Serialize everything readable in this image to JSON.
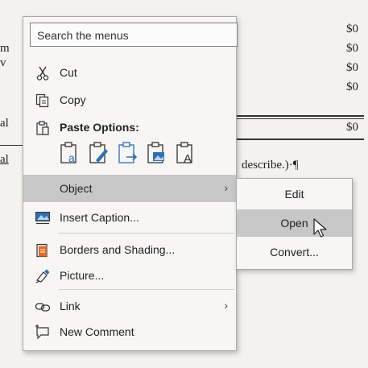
{
  "document": {
    "amounts": [
      "$0",
      "$0",
      "$0",
      "$0",
      "$0"
    ],
    "fragments": [
      "m",
      "v",
      "al",
      "al"
    ],
    "describe_text": "describe.)·¶"
  },
  "context_menu": {
    "search_placeholder": "Search the menus",
    "items": [
      {
        "label": "Cut",
        "icon": "scissors-icon"
      },
      {
        "label": "Copy",
        "icon": "copy-icon"
      },
      {
        "label": "Paste Options:",
        "icon": "clipboard-icon"
      },
      {
        "label": "Object",
        "has_submenu": true,
        "highlighted": true
      },
      {
        "label": "Insert Caption...",
        "icon": "insert-caption-icon"
      },
      {
        "label": "Borders and Shading...",
        "icon": "borders-shading-icon"
      },
      {
        "label": "Picture...",
        "icon": "picture-format-icon"
      },
      {
        "label": "Link",
        "icon": "link-icon",
        "has_submenu": true
      },
      {
        "label": "New Comment",
        "icon": "new-comment-icon"
      }
    ],
    "paste_options": [
      "paste-keep-source-formatting-icon",
      "paste-merge-formatting-icon",
      "paste-picture-icon",
      "paste-linked-picture-icon",
      "paste-keep-text-only-icon"
    ],
    "chevron": "›"
  },
  "submenu": {
    "items": [
      {
        "label": "Edit"
      },
      {
        "label": "Open",
        "highlighted": true
      },
      {
        "label": "Convert..."
      }
    ]
  },
  "colors": {
    "menu_bg": "#f7f6f4",
    "highlight": "#c7c7c7",
    "icon_blue": "#2f6fb3"
  }
}
